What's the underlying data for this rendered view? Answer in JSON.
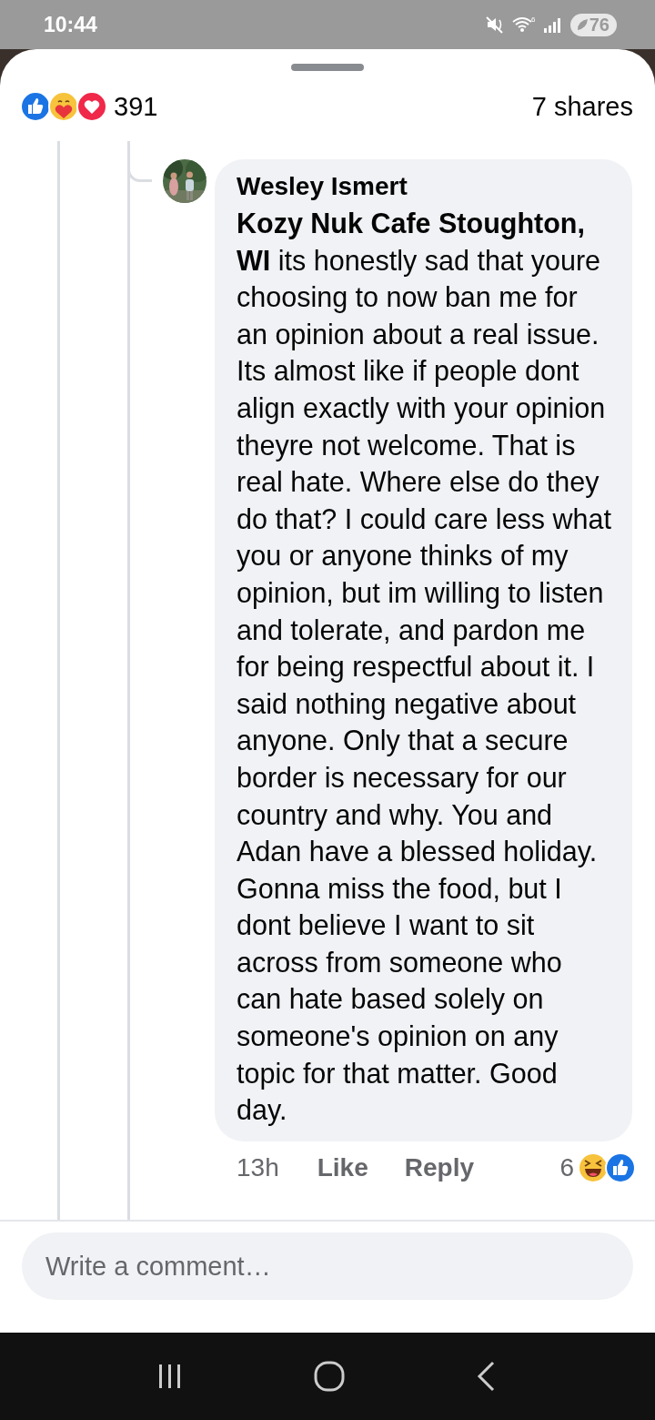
{
  "status_bar": {
    "time": "10:44",
    "wifi_label": "6",
    "battery": "76"
  },
  "post_summary": {
    "reactions": [
      {
        "kind": "like"
      },
      {
        "kind": "care"
      },
      {
        "kind": "love"
      }
    ],
    "reaction_count": "391",
    "shares": "7 shares"
  },
  "comment": {
    "author": "Wesley Ismert",
    "text": "**Kozy Nuk Cafe Stoughton, WI** its honestly sad that youre choosing to now ban me for an opinion about a real issue.  Its almost like if people dont align exactly with your opinion theyre not welcome. That is real hate. Where else do they do that? I could care less what you or anyone thinks of my opinion, but im willing to listen and tolerate, and pardon me for being respectful about it. I said nothing negative about anyone. Only that a secure border is necessary for our country and why. You and Adan have a blessed holiday. Gonna miss the food, but I dont believe I want to sit across from someone who can hate based solely on someone's opinion on any topic for that matter. Good day.",
    "time": "13h",
    "actions": [
      "Like",
      "Reply"
    ],
    "reaction_count": "6",
    "reactions": [
      {
        "kind": "haha"
      },
      {
        "kind": "like"
      }
    ]
  },
  "composer": {
    "placeholder": "Write a comment…"
  }
}
